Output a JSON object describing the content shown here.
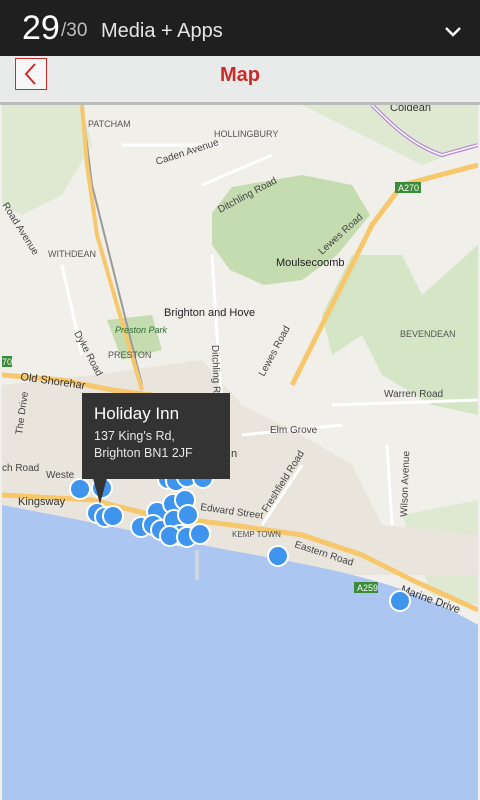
{
  "topbar": {
    "index": "29",
    "total": "/30",
    "section": "Media + Apps"
  },
  "header": {
    "title": "Map"
  },
  "map": {
    "labels": {
      "hollingbury": "HOLLINGBURY",
      "coldean": "Coldean",
      "patcham": "PATCHAM",
      "caden_avenue": "Caden Avenue",
      "ditchling_road": "Ditchling Road",
      "a270": "A270",
      "lewes_road_top": "Lewes Road",
      "withdean": "WITHDEAN",
      "moulsecoomb": "Moulsecoomb",
      "brighton_hove": "Brighton and Hove",
      "lewes_road": "Lewes Road",
      "bevendean": "BEVENDEAN",
      "preston_park": "Preston Park",
      "preston": "PRESTON",
      "dyke_road": "Dyke Road",
      "ditchling_road2": "Ditchling Road",
      "old_shoreham": "Old Shorehar",
      "warren_road": "Warren Road",
      "elm_grove": "Elm Grove",
      "freshfield_road": "Freshfield Road",
      "wilson_avenue": "Wilson Avenue",
      "kingsway": "Kingsway",
      "edward_street": "Edward Street",
      "kemp_town": "KEMP TOWN",
      "eastern_road": "Eastern Road",
      "a259": "A259",
      "marine_drive": "Marine Drive",
      "the_drive": "The Drive",
      "church_road": "ch Road",
      "western": "Weste",
      "road_avenue": "Road Avenue",
      "a270_left": "70",
      "n_label": "n"
    }
  },
  "popup": {
    "title": "Holiday Inn",
    "address_line1": "137 King's Rd,",
    "address_line2": "Brighton BN1 2JF"
  },
  "colors": {
    "accent": "#cf2a2a",
    "marker": "#3f95ee",
    "sea": "#abc6f0",
    "land": "#f1efe9",
    "park": "#c5dcb1"
  },
  "icons": {
    "back": "chevron-left-icon",
    "expand": "chevron-down-icon"
  }
}
